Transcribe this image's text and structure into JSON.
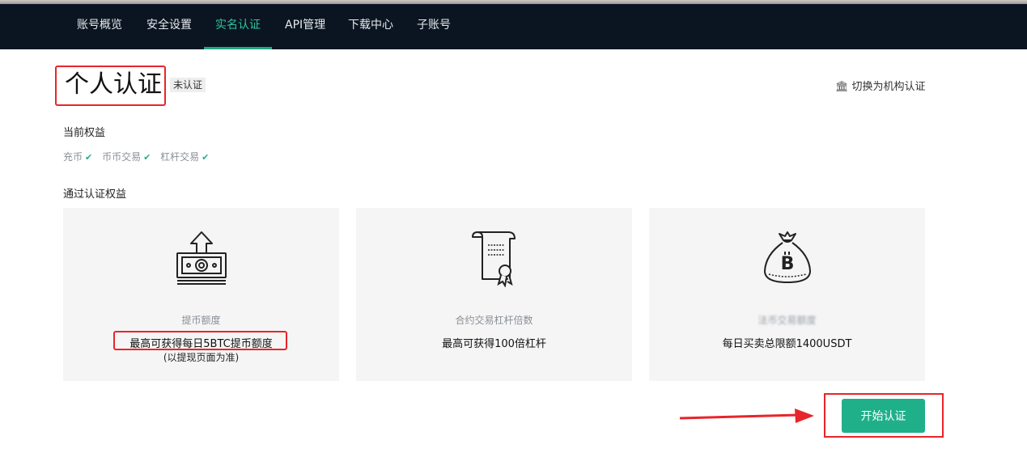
{
  "nav": {
    "items": [
      {
        "label": "账号概览"
      },
      {
        "label": "安全设置"
      },
      {
        "label": "实名认证"
      },
      {
        "label": "API管理"
      },
      {
        "label": "下载中心"
      },
      {
        "label": "子账号"
      }
    ],
    "active_label": "实名认证"
  },
  "header": {
    "title": "个人认证",
    "status_badge": "未认证",
    "switch_link": "切换为机构认证",
    "switch_icon": "bank-icon"
  },
  "current_rights": {
    "heading": "当前权益",
    "items": [
      "充币",
      "币币交易",
      "杠杆交易"
    ]
  },
  "verified_rights": {
    "heading": "通过认证权益",
    "cards": [
      {
        "icon": "withdraw-cash-icon",
        "label": "提币额度",
        "value": "最高可获得每日5BTC提币额度",
        "note": "(以提现页面为准)"
      },
      {
        "icon": "contract-certificate-icon",
        "label": "合约交易杠杆倍数",
        "value": "最高可获得100倍杠杆"
      },
      {
        "icon": "bitcoin-bag-icon",
        "label": "法币交易额度",
        "value": "每日买卖总限额1400USDT"
      }
    ]
  },
  "cta": {
    "label": "开始认证"
  },
  "colors": {
    "nav_bg": "#0b1521",
    "accent": "#1fb08a",
    "highlight_red": "#e8252a",
    "card_bg": "#f5f5f5"
  }
}
